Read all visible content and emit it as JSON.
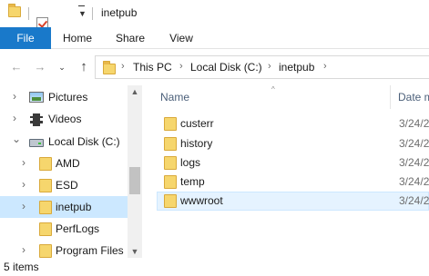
{
  "window": {
    "title": "inetpub"
  },
  "ribbon": {
    "tabs": [
      "File",
      "Home",
      "Share",
      "View"
    ]
  },
  "navigation": {
    "breadcrumb": [
      "This PC",
      "Local Disk (C:)",
      "inetpub"
    ]
  },
  "tree": {
    "items": [
      {
        "label": "Pictures",
        "icon": "pictures-icon",
        "expander": "›"
      },
      {
        "label": "Videos",
        "icon": "videos-icon",
        "expander": "›"
      },
      {
        "label": "Local Disk (C:)",
        "icon": "drive-icon",
        "expander": "⌄"
      },
      {
        "label": "AMD",
        "icon": "folder-icon",
        "expander": "›"
      },
      {
        "label": "ESD",
        "icon": "folder-icon",
        "expander": "›"
      },
      {
        "label": "inetpub",
        "icon": "folder-icon",
        "expander": "›",
        "selected": true
      },
      {
        "label": "PerfLogs",
        "icon": "folder-icon",
        "expander": ""
      },
      {
        "label": "Program Files",
        "icon": "folder-icon",
        "expander": "›"
      }
    ]
  },
  "file_list": {
    "columns": {
      "name": "Name",
      "date": "Date m"
    },
    "rows": [
      {
        "name": "custerr",
        "date": "3/24/2"
      },
      {
        "name": "history",
        "date": "3/24/2"
      },
      {
        "name": "logs",
        "date": "3/24/2"
      },
      {
        "name": "temp",
        "date": "3/24/2"
      },
      {
        "name": "wwwroot",
        "date": "3/24/2",
        "hovered": true
      }
    ]
  },
  "status_bar": {
    "item_count": "5 items"
  },
  "colors": {
    "accent": "#1979ca",
    "selection": "#cce8ff",
    "folder": "#f6d66d"
  }
}
